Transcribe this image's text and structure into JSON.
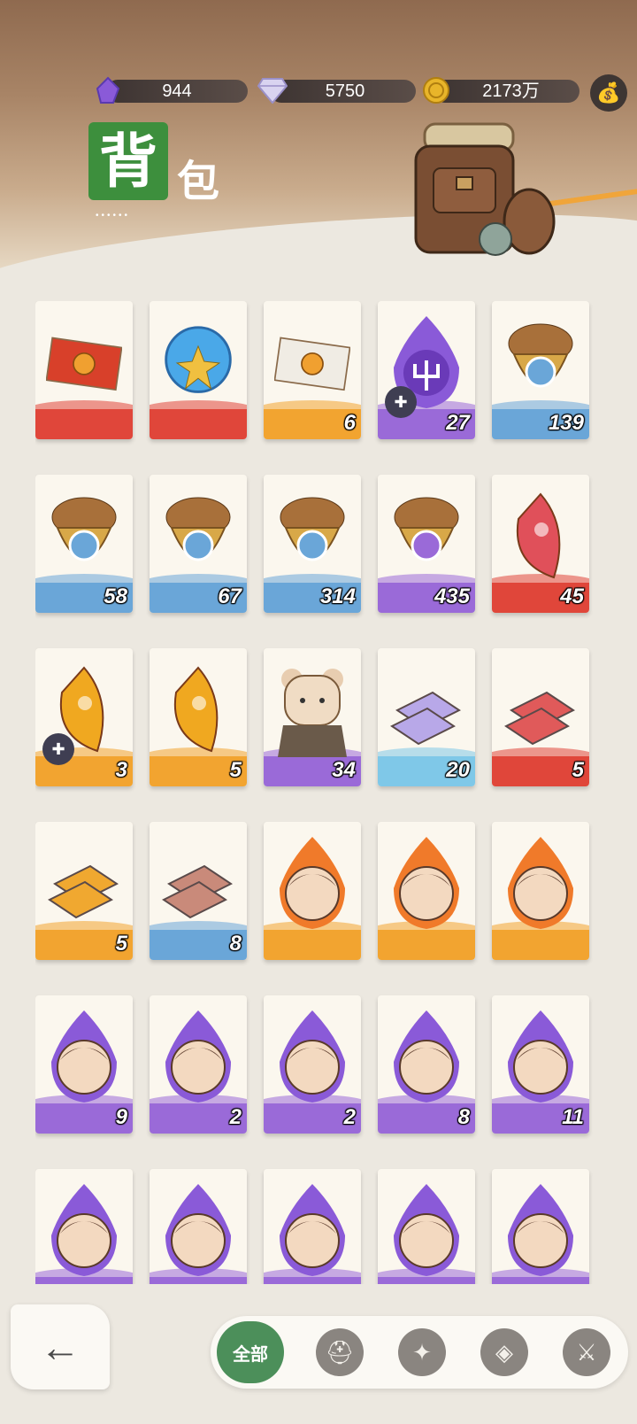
{
  "resources": [
    {
      "icon": "purple-crystal-icon",
      "value": "944",
      "color": "#8a5ad8"
    },
    {
      "icon": "diamond-icon",
      "value": "5750",
      "color": "#c9c2e8"
    },
    {
      "icon": "gold-coin-icon",
      "value": "2173万",
      "color": "#e8b52a"
    }
  ],
  "title": {
    "main": "背",
    "sub": "包",
    "dots": "••••••"
  },
  "items": [
    {
      "icon": "red-envelope-item-icon",
      "count": "",
      "base": "#e0463a",
      "puzzle": false
    },
    {
      "icon": "blue-orb-item-icon",
      "count": "",
      "base": "#e0463a",
      "puzzle": false
    },
    {
      "icon": "white-envelope-item-icon",
      "count": "6",
      "base": "#f2a430",
      "puzzle": false
    },
    {
      "icon": "purple-trident-flame-icon",
      "count": "27",
      "base": "#9a6ad8",
      "puzzle": true
    },
    {
      "icon": "acorn-green-eye-icon",
      "count": "139",
      "base": "#6aa6d8",
      "puzzle": false
    },
    {
      "icon": "acorn-red-target-icon",
      "count": "58",
      "base": "#6aa6d8",
      "puzzle": false
    },
    {
      "icon": "acorn-leaf-icon",
      "count": "67",
      "base": "#6aa6d8",
      "puzzle": false
    },
    {
      "icon": "acorn-blue-star-icon",
      "count": "314",
      "base": "#6aa6d8",
      "puzzle": false
    },
    {
      "icon": "acorn-diamond-icon",
      "count": "435",
      "base": "#9a6ad8",
      "puzzle": false
    },
    {
      "icon": "red-rune-crystal-icon",
      "count": "45",
      "base": "#e0463a",
      "puzzle": false
    },
    {
      "icon": "gold-rune-crystal-icon",
      "count": "3",
      "base": "#f2a430",
      "puzzle": true
    },
    {
      "icon": "gold-rune-crystal-icon",
      "count": "5",
      "base": "#f2a430",
      "puzzle": false
    },
    {
      "icon": "bear-figure-icon",
      "count": "34",
      "base": "#9a6ad8",
      "puzzle": false
    },
    {
      "icon": "purple-ingot-icon",
      "count": "20",
      "base": "#7fc8e8",
      "puzzle": false
    },
    {
      "icon": "red-ingot-icon",
      "count": "5",
      "base": "#e0463a",
      "puzzle": false
    },
    {
      "icon": "gold-ingot-icon",
      "count": "5",
      "base": "#f2a430",
      "puzzle": false
    },
    {
      "icon": "copper-ingot-icon",
      "count": "8",
      "base": "#6aa6d8",
      "puzzle": false
    },
    {
      "icon": "fire-hero-portrait-icon",
      "count": "",
      "base": "#f2a430",
      "puzzle": false
    },
    {
      "icon": "fire-hero-portrait-icon",
      "count": "",
      "base": "#f2a430",
      "puzzle": false
    },
    {
      "icon": "fire-hero-portrait-icon",
      "count": "",
      "base": "#f2a430",
      "puzzle": false
    },
    {
      "icon": "purple-hero-portrait-icon",
      "count": "9",
      "base": "#9a6ad8",
      "puzzle": false
    },
    {
      "icon": "purple-hero-portrait-icon",
      "count": "2",
      "base": "#9a6ad8",
      "puzzle": false
    },
    {
      "icon": "purple-hero-portrait-icon",
      "count": "2",
      "base": "#9a6ad8",
      "puzzle": false
    },
    {
      "icon": "purple-hero-portrait-icon",
      "count": "8",
      "base": "#9a6ad8",
      "puzzle": false
    },
    {
      "icon": "purple-hero-portrait-icon",
      "count": "11",
      "base": "#9a6ad8",
      "puzzle": false
    },
    {
      "icon": "purple-hero-portrait-icon",
      "count": "",
      "base": "#9a6ad8",
      "puzzle": false
    },
    {
      "icon": "purple-hero-portrait-icon",
      "count": "",
      "base": "#9a6ad8",
      "puzzle": false
    },
    {
      "icon": "purple-hero-portrait-icon",
      "count": "",
      "base": "#9a6ad8",
      "puzzle": false
    },
    {
      "icon": "purple-hero-portrait-icon",
      "count": "",
      "base": "#9a6ad8",
      "puzzle": false
    },
    {
      "icon": "purple-hero-portrait-icon",
      "count": "",
      "base": "#9a6ad8",
      "puzzle": false
    }
  ],
  "nav": {
    "back_icon": "back-arrow-icon",
    "tabs": [
      {
        "label": "全部",
        "icon": "",
        "active": true
      },
      {
        "label": "",
        "icon": "helmet-icon",
        "active": false
      },
      {
        "label": "",
        "icon": "compass-star-icon",
        "active": false
      },
      {
        "label": "",
        "icon": "gem-icon",
        "active": false
      },
      {
        "label": "",
        "icon": "sword-shield-icon",
        "active": false
      }
    ]
  }
}
